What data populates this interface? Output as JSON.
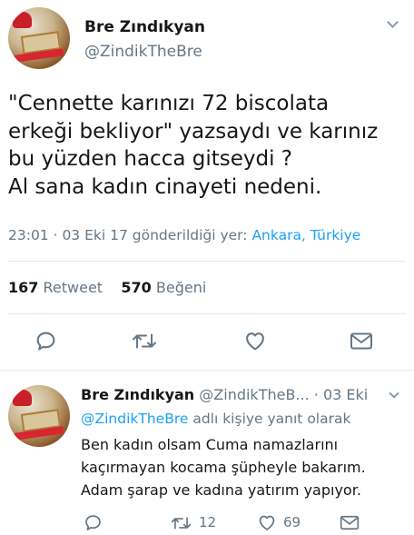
{
  "tweet": {
    "author_name": "Bre Zındıkyan",
    "author_handle": "@ZindikTheBre",
    "text_lines": [
      "\"Cennette karınızı 72 biscolata",
      "erkeği bekliyor\" yazsaydı ve karınız",
      "bu yüzden hacca gitseydi ?",
      "Al sana kadın cinayeti nedeni."
    ],
    "meta_time": "23:01 · 03 Eki 17 gönderildiği yer: ",
    "meta_location": "Ankara, Türkiye",
    "retweet_count": "167",
    "retweet_label": "Retweet",
    "like_count": "570",
    "like_label": "Beğeni"
  },
  "reply": {
    "author_name": "Bre Zındıkyan",
    "author_handle": "@ZindikTheB...",
    "date": "· 03 Eki",
    "context_mention": "@ZindikTheBre",
    "context_text": " adlı kişiye yanıt olarak",
    "text_lines": [
      "Ben kadın olsam Cuma namazlarını",
      "kaçırmayan kocama şüpheyle bakarım.",
      "Adam şarap ve kadına yatırım yapıyor."
    ],
    "retweet_count": "12",
    "like_count": "69"
  },
  "icons": [
    "reply-icon",
    "retweet-icon",
    "heart-icon",
    "envelope-icon",
    "chevron-down-icon"
  ],
  "colors": {
    "link": "#1da1f2",
    "secondary_text": "#657786",
    "divider": "#e1e8ed"
  }
}
